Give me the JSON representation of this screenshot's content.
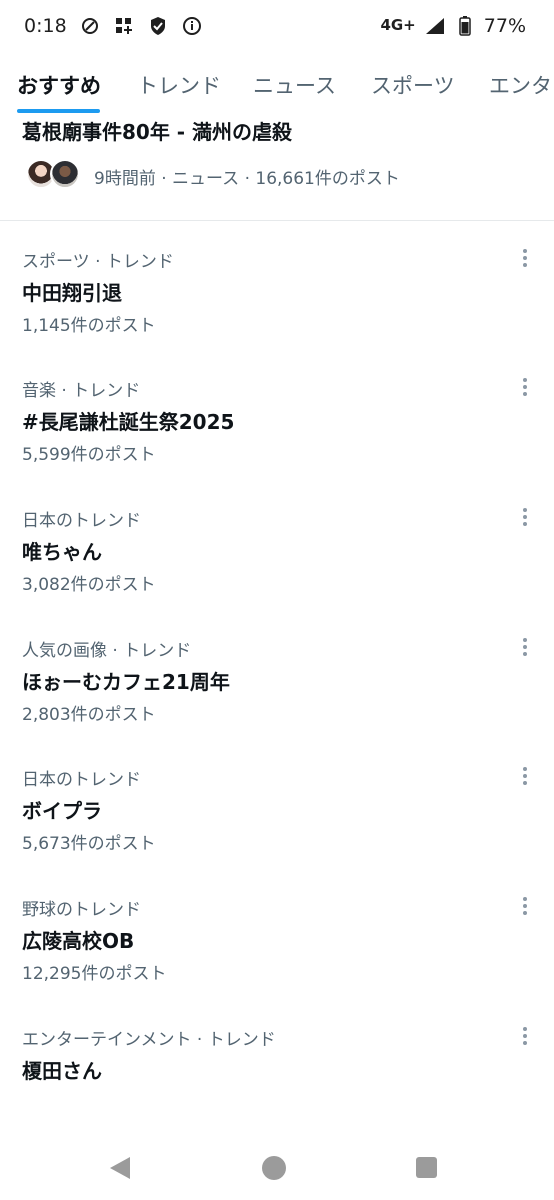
{
  "status_bar": {
    "time": "0:18",
    "network": "4G+",
    "battery": "77%"
  },
  "tabs": [
    {
      "label": "おすすめ",
      "active": true
    },
    {
      "label": "トレンド",
      "active": false
    },
    {
      "label": "ニュース",
      "active": false
    },
    {
      "label": "スポーツ",
      "active": false
    },
    {
      "label": "エンタ",
      "active": false
    }
  ],
  "news": {
    "title": "葛根廟事件80年 - 満州の虐殺",
    "meta": "9時間前 · ニュース · 16,661件のポスト"
  },
  "trends": [
    {
      "category": "スポーツ · トレンド",
      "name": "中田翔引退",
      "count": "1,145件のポスト"
    },
    {
      "category": "音楽 · トレンド",
      "name": "#長尾謙杜誕生祭2025",
      "count": "5,599件のポスト"
    },
    {
      "category": "日本のトレンド",
      "name": "唯ちゃん",
      "count": "3,082件のポスト"
    },
    {
      "category": "人気の画像 · トレンド",
      "name": "ほぉーむカフェ21周年",
      "count": "2,803件のポスト"
    },
    {
      "category": "日本のトレンド",
      "name": "ボイプラ",
      "count": "5,673件のポスト"
    },
    {
      "category": "野球のトレンド",
      "name": "広陵高校OB",
      "count": "12,295件のポスト"
    },
    {
      "category": "エンターテインメント · トレンド",
      "name": "榎田さん",
      "count": ""
    }
  ],
  "colors": {
    "accent": "#1d9bf0",
    "text_primary": "#0f1419",
    "text_secondary": "#536471"
  },
  "icons": {
    "status_left": [
      "data-saver-icon",
      "app-grid-icon",
      "shield-icon",
      "info-icon"
    ],
    "status_right": [
      "signal-icon",
      "battery-icon"
    ],
    "nav": [
      "back-icon",
      "home-icon",
      "recents-icon"
    ]
  }
}
